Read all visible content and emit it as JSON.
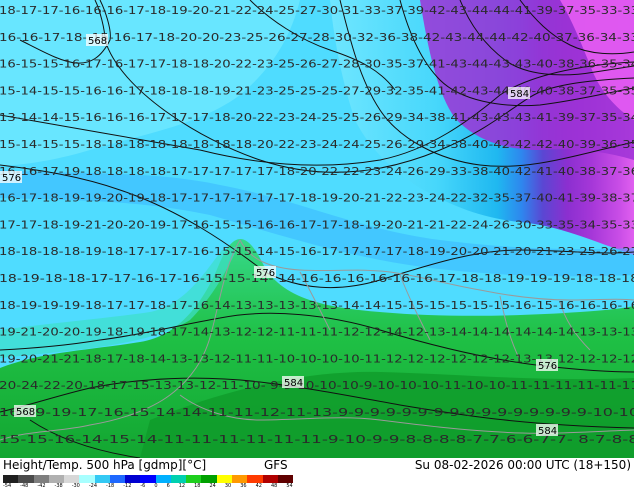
{
  "footer": {
    "title": "Height/Temp. 500 hPa [gdmp][°C]",
    "model": "GFS",
    "date": "Su 08-02-2026 00:00 UTC (18+150)"
  },
  "colorbar": {
    "labels": [
      "-54",
      "-48",
      "-42",
      "-38",
      "-30",
      "-24",
      "-18",
      "-12",
      "-6",
      "0",
      "6",
      "12",
      "18",
      "24",
      "30",
      "36",
      "42",
      "48",
      "54"
    ],
    "colors": [
      "#1f1f1f",
      "#4b4b4b",
      "#7e7e7e",
      "#b0b0b0",
      "#d8d8d8",
      "#a8ffff",
      "#34c9f4",
      "#1e68ff",
      "#0000d0",
      "#0000ff",
      "#00b0ff",
      "#00d0b0",
      "#1ecf1e",
      "#00a000",
      "#ffff00",
      "#ff9900",
      "#ff3b00",
      "#b00000",
      "#600000"
    ]
  },
  "contour_labels": [
    "568",
    "576",
    "576",
    "584",
    "576",
    "584",
    "568",
    "584"
  ],
  "temperature_rows": [
    "18-17-17-16-16-16-17-18-19-20-21-22-24-25-27-30-31-33-37-39-42-43-44-44-41-39-37-35-33-33",
    "16-16-17-18-    15-16-17-18-20-20-23-25-26-27-28-30-32-36-38-42-43-44-44-42-40-37-36-34-33",
    "16-15-15-16-17-16-17-17-18-18-20-22-23-25-26-27-28-30-35-37-41-43-44-43-43-40-38-36-35-34",
    "15-14-15-15-16-16-17-18-18-18-19-21-23-25-25-25-27-29-32-35-41-42-43-44-40-40-38-37-35-35",
    "13-14-14-15-16-16-16-17-17-17-18-20-22-23-24-25-25-26-29-34-38-41-43-43-43-41-39-37-35-34",
    "15-14-15-15-18-18-18-18-18-18-18-18-20-22-23-24-24-25-26-29-34-38-40-42-42-42-40-39-36-35",
    "16-16-17-19-18-18-18-18-17-17-17-17-17-18-20-22-22-23-24-26-29-33-38-40-42-41-40-38-37-36",
    "16-17-18-19-19-20-19-18-17-17-17-17-17-17-18-19-20-21-22-23-24-22-32-35-37-40-41-39-38-37",
    "17-17-18-19-21-20-20-19-17-16-15-15-16-16-17-17-18-19-20-21-21-22-24-26-30-33-35-34-35-33",
    "18-18-18-18-19-18-17-17-17-16-15-15-14-15-16-17-17-17-17-18-19-20-20-21-20-21-23-25-26-27",
    "18-19-18-18-17-17-16-17-16-15-15-14-    14-16-16-16-16-16-16-17-18-18-19-19-19-18-18-18",
    "18-19-19-19-18-17-17-18-17-16-14-13-13-13-13-13-14-14-15-15-15-15-15-15-16-15-16-16-16-16",
    "19-21-20-20-19-18-19-18-17-14-13-12-12-11-11-11-12-12-14-12-13-14-14-14-14-14-14-13-13-13",
    "19-20-21-21-18-17-18-14-13-13-12-11-11-10-10-10-10-11-12-12-12-12-12-12-13-13-12-12-12-12",
    "20-24-22-20-18-17-15-13-13-12-11-10-    9-9-10-10-10-9-10-10-10-11-10-10-11-11-11-11-11-11",
    "16-19-19-17-16-15-14-14-11-11-12-11-13-9-9-9-9-9-9-9-9-9-9-9-9-9-9-9-9-10-10",
    "15-15-16-14-15-14-11-11-11-11-11-11-9-10-9-9-8-8-8-8-7-7-6-6-7-7-    8-7-8-8"
  ]
}
